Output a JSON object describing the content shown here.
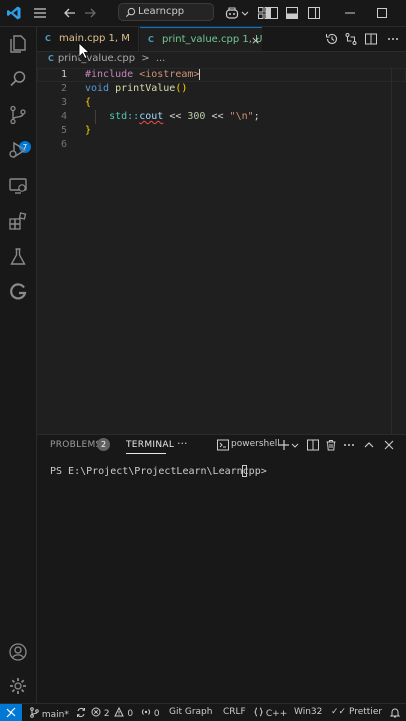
{
  "titlebar": {
    "search_text": "Learncpp"
  },
  "activity_bar": {
    "items": [
      "explorer",
      "search",
      "source-control",
      "run-debug",
      "remote-explorer",
      "extensions",
      "testing",
      "gitlens"
    ],
    "scm_badge": "7"
  },
  "tabs": [
    {
      "icon": "C",
      "label": "main.cpp",
      "status": "1, M",
      "color": "#e2c08d"
    },
    {
      "icon": "C",
      "label": "print_value.cpp",
      "status": "1, U",
      "color": "#73c991",
      "close": "×"
    }
  ],
  "breadcrumb": {
    "file": "print_value.cpp",
    "separator": ">",
    "more": "..."
  },
  "editor": {
    "line_numbers": [
      "1",
      "2",
      "3",
      "4",
      "5",
      "6"
    ],
    "lines": [
      {
        "include": "#include",
        "header": "<iostream>"
      },
      {
        "type": "void",
        "name": "printValue",
        "parens": "()"
      },
      {
        "text": "{"
      },
      {
        "ns": "std::",
        "cout": "cout",
        "op1": " << ",
        "num": "300",
        "op2": " << ",
        "str": "\"\\n\"",
        "end": ";"
      },
      {
        "text": "}"
      },
      {
        "text": ""
      }
    ]
  },
  "panel": {
    "problems_label": "PROBLEMS",
    "problems_count": "2",
    "terminal_label": "TERMINAL",
    "more": "···",
    "shell": "powershell",
    "terminal_line": "PS E:\\Project\\ProjectLearn\\Learncpp>"
  },
  "statusbar": {
    "branch": "main*",
    "errors": "2",
    "warnings": "0",
    "ports": "0",
    "git_graph": "Git Graph",
    "eol": "CRLF",
    "language": "C++",
    "platform": "Win32",
    "prettier": "Prettier"
  },
  "colors": {
    "accent": "#0078d4",
    "modified": "#e2c08d",
    "untracked": "#73c991",
    "error_squiggle": "#f14c4c"
  }
}
